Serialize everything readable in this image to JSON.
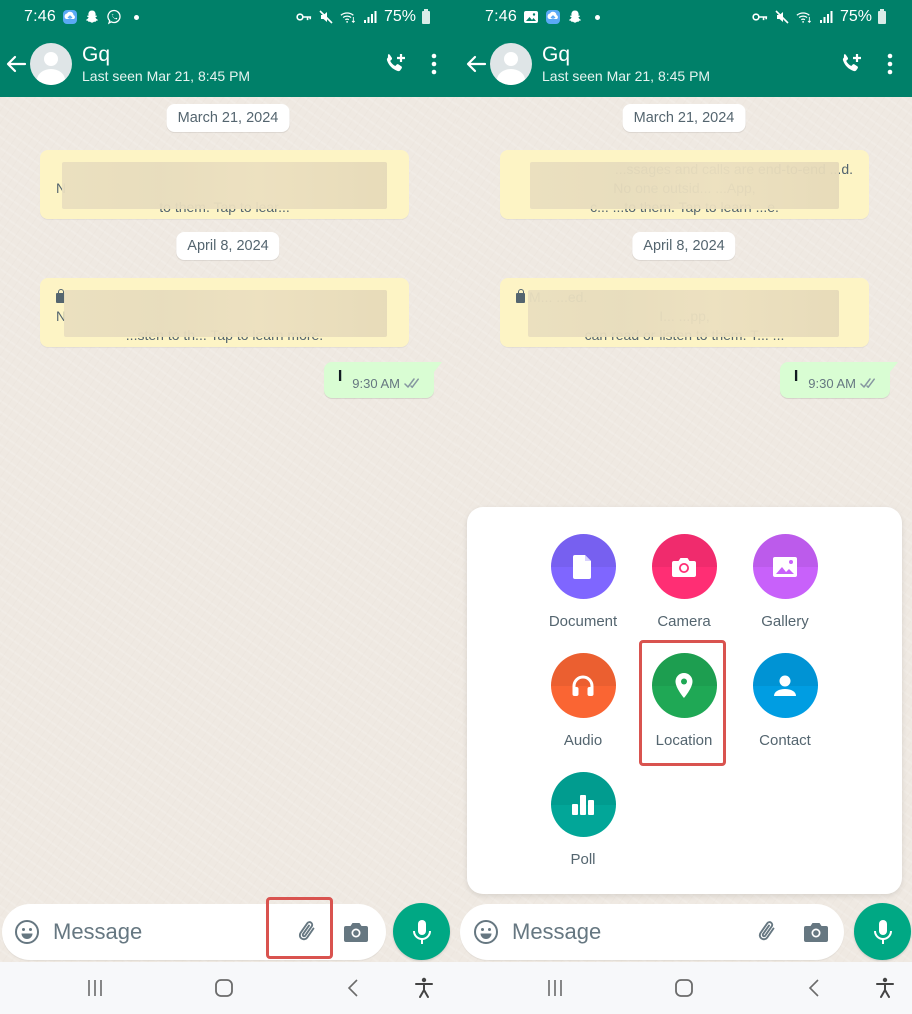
{
  "colors": {
    "header_bg": "#008069",
    "accent_green": "#00a884",
    "outgoing_bubble": "#d9fdd3",
    "system_message_bg": "#fdf4c5",
    "highlight_red": "#d9534f",
    "attach_document": "#7f66ff",
    "attach_camera": "#ff2e74",
    "attach_gallery": "#c861fa",
    "attach_audio": "#fa6533",
    "attach_location": "#1fa855",
    "attach_contact": "#009de2",
    "attach_poll": "#02a698"
  },
  "screens": [
    {
      "id": "left",
      "status_bar": {
        "time": "7:46",
        "notification_icons": [
          "cloud-upload-icon",
          "snapchat-icon",
          "viber-icon",
          "dot-icon"
        ],
        "system_icons": [
          "vpn-key-icon",
          "mute-icon",
          "wifi-icon",
          "signal-icon"
        ],
        "battery": "75%"
      },
      "header": {
        "contact_name": "Gq",
        "last_seen": "Last seen Mar 21, 8:45 PM"
      },
      "chat": {
        "date_chips": [
          "March 21, 2024",
          "April 8, 2024"
        ],
        "system_messages": [
          {
            "lines": [
              "",
              "N",
              "to them. Tap to lear..."
            ],
            "redacted": true
          },
          {
            "lines": [
              "",
              "N",
              "...sten to th... Tap to learn more."
            ],
            "redacted": true,
            "has_lock": true
          }
        ],
        "outgoing_message": {
          "text": "I",
          "time": "9:30 AM",
          "status": "read"
        }
      },
      "input": {
        "placeholder": "Message",
        "value": "",
        "highlighted_button": "attach"
      }
    },
    {
      "id": "right",
      "status_bar": {
        "time": "7:46",
        "notification_icons": [
          "gallery-icon",
          "cloud-upload-icon",
          "snapchat-icon",
          "dot-icon"
        ],
        "system_icons": [
          "vpn-key-icon",
          "mute-icon",
          "wifi-icon",
          "signal-icon"
        ],
        "battery": "75%"
      },
      "header": {
        "contact_name": "Gq",
        "last_seen": "Last seen Mar 21, 8:45 PM"
      },
      "chat": {
        "date_chips": [
          "March 21, 2024",
          "April 8, 2024"
        ],
        "system_messages": [
          {
            "lines": [
              "...ssages and calls are end-to-end ...d.",
              "No one outsid... ...App,",
              "c... ...to them. Tap to learn ...e."
            ],
            "redacted": true
          },
          {
            "lines": [
              "M... ...ed.",
              "I... ...pp,",
              "can read or listen to them. T... ..."
            ],
            "redacted": true,
            "has_lock": true
          }
        ],
        "outgoing_message": {
          "text": "I",
          "time": "9:30 AM",
          "status": "read"
        }
      },
      "attach_menu": {
        "items": [
          {
            "label": "Document",
            "icon": "document-icon"
          },
          {
            "label": "Camera",
            "icon": "camera-icon"
          },
          {
            "label": "Gallery",
            "icon": "gallery-icon"
          },
          {
            "label": "Audio",
            "icon": "headphones-icon"
          },
          {
            "label": "Location",
            "icon": "location-pin-icon",
            "highlighted": true
          },
          {
            "label": "Contact",
            "icon": "person-icon"
          },
          {
            "label": "Poll",
            "icon": "poll-icon"
          }
        ]
      },
      "input": {
        "placeholder": "Message",
        "value": ""
      }
    }
  ],
  "nav_bar": {
    "buttons": [
      "recent-apps",
      "home",
      "back",
      "accessibility"
    ]
  }
}
